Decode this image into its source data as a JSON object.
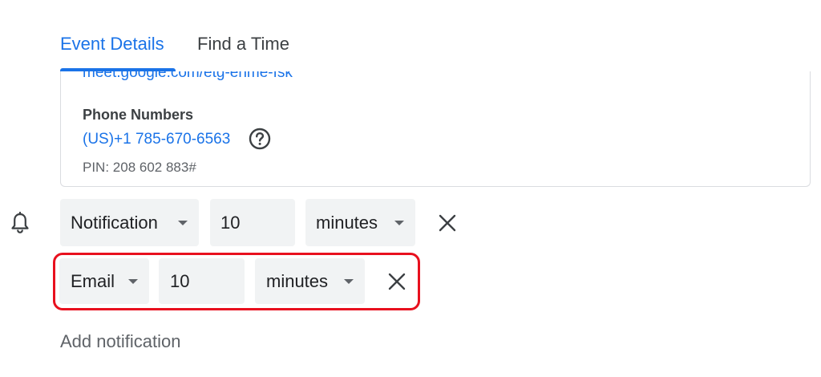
{
  "tabs": {
    "event_details": "Event Details",
    "find_a_time": "Find a Time"
  },
  "conference": {
    "meet_link": "meet.google.com/etg-enme-fsk",
    "phone_title": "Phone Numbers",
    "phone_number": "(US)+1 785-670-6563",
    "pin": "PIN: 208 602 883#"
  },
  "notifications": [
    {
      "type": "Notification",
      "amount": "10",
      "unit": "minutes"
    },
    {
      "type": "Email",
      "amount": "10",
      "unit": "minutes"
    }
  ],
  "add_notification": "Add notification",
  "colors": {
    "accent": "#1a73e8",
    "highlight": "#e8101e",
    "field_bg": "#f1f3f4"
  }
}
